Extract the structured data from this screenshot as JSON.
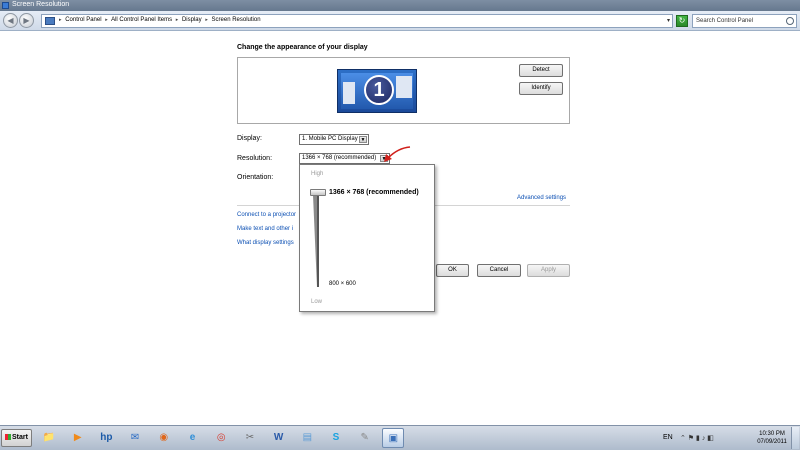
{
  "window": {
    "title": "Screen Resolution"
  },
  "nav": {
    "back": "◀",
    "forward": "▶",
    "breadcrumbs": [
      "Control Panel",
      "All Control Panel Items",
      "Display",
      "Screen Resolution"
    ],
    "separator": "▸",
    "search_placeholder": "Search Control Panel"
  },
  "page": {
    "heading": "Change the appearance of your display",
    "monitor_number": "1",
    "detect_label": "Detect",
    "identify_label": "Identify",
    "display_label": "Display:",
    "display_value": "1. Mobile PC Display",
    "resolution_label": "Resolution:",
    "resolution_value": "1366 × 768 (recommended)",
    "orientation_label": "Orientation:",
    "advanced_settings": "Advanced settings",
    "links": [
      "Connect to a projector",
      "Make text and other i",
      "What display settings"
    ],
    "ok_label": "OK",
    "cancel_label": "Cancel",
    "apply_label": "Apply"
  },
  "popup": {
    "high_label": "High",
    "low_label": "Low",
    "max_resolution": "1366 × 768 (recommended)",
    "min_resolution": "800 × 600",
    "slider_level": 1.0
  },
  "taskbar": {
    "start_label": "Start",
    "icons": [
      "folder-icon",
      "media-player-icon",
      "hp-icon",
      "mail-icon",
      "firefox-icon",
      "ie-icon",
      "chrome-icon",
      "tools-icon",
      "word-icon",
      "notepad-icon",
      "skype-icon",
      "utility-icon",
      "display-settings-icon"
    ],
    "language": "EN",
    "time": "10:30 PM",
    "date": "07/09/2011"
  },
  "colors": {
    "link": "#0b4fb3",
    "annotation": "#d0201b",
    "monitor": "#2d6fc7"
  }
}
